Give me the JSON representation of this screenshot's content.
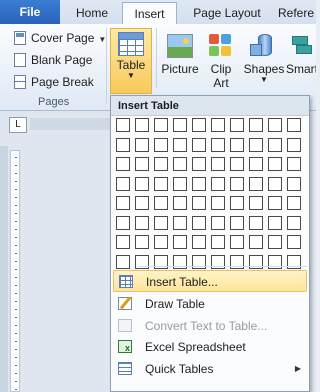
{
  "tabs": {
    "file": "File",
    "home": "Home",
    "insert": "Insert",
    "page_layout": "Page Layout",
    "references": "Refere"
  },
  "ribbon": {
    "pages_group": {
      "label": "Pages",
      "cover_page": "Cover Page",
      "blank_page": "Blank Page",
      "page_break": "Page Break"
    },
    "table": "Table",
    "picture": "Picture",
    "clip_art_line1": "Clip",
    "clip_art_line2": "Art",
    "shapes": "Shapes",
    "smartart": "Smart"
  },
  "ruler_corner": "L",
  "insert_table_menu": {
    "header": "Insert Table",
    "grid_columns": 10,
    "grid_rows": 8,
    "items": [
      {
        "label": "Insert Table...",
        "icon": "insert-table-icon",
        "active": true,
        "disabled": false
      },
      {
        "label": "Draw Table",
        "icon": "draw-table-icon",
        "active": false,
        "disabled": false
      },
      {
        "label": "Convert Text to Table...",
        "icon": "convert-text-icon",
        "active": false,
        "disabled": true
      },
      {
        "label": "Excel Spreadsheet",
        "icon": "excel-spreadsheet-icon",
        "active": false,
        "disabled": false
      },
      {
        "label": "Quick Tables",
        "icon": "quick-tables-icon",
        "active": false,
        "disabled": false,
        "submenu": true
      }
    ]
  },
  "colors": {
    "file_tab": "#2a63b9",
    "highlight": "#fde59a",
    "highlight_border": "#e8c25e"
  }
}
